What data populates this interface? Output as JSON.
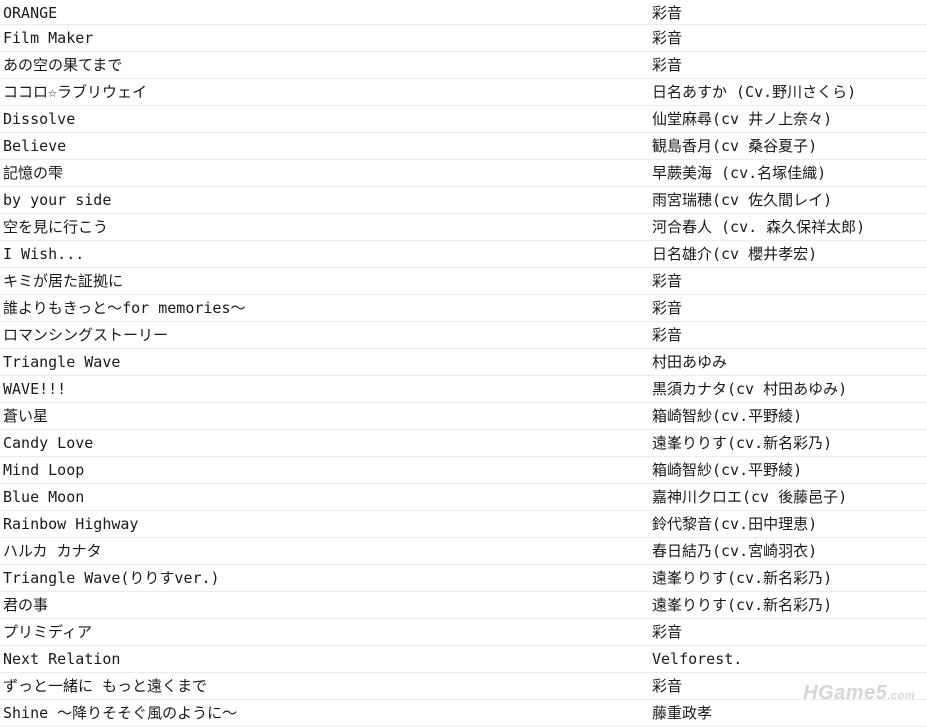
{
  "songs": [
    {
      "title": "ORANGE",
      "artist": "彩音"
    },
    {
      "title": "Film Maker",
      "artist": "彩音"
    },
    {
      "title": "あの空の果てまで",
      "artist": "彩音"
    },
    {
      "title": "ココロ☆ラブリウェイ",
      "artist": "日名あすか (Cv.野川さくら)"
    },
    {
      "title": "Dissolve",
      "artist": "仙堂麻尋(cv 井ノ上奈々)"
    },
    {
      "title": "Believe",
      "artist": "観島香月(cv 桑谷夏子)"
    },
    {
      "title": "記憶の雫",
      "artist": "早蕨美海 (cv.名塚佳織)"
    },
    {
      "title": "by your side",
      "artist": "雨宮瑞穂(cv 佐久間レイ)"
    },
    {
      "title": "空を見に行こう",
      "artist": "河合春人 (cv. 森久保祥太郎)"
    },
    {
      "title": "I Wish...",
      "artist": "日名雄介(cv 櫻井孝宏)"
    },
    {
      "title": "キミが居た証拠に",
      "artist": "彩音"
    },
    {
      "title": "誰よりもきっと～for memories～",
      "artist": "彩音"
    },
    {
      "title": "ロマンシングストーリー",
      "artist": "彩音"
    },
    {
      "title": "Triangle Wave",
      "artist": "村田あゆみ"
    },
    {
      "title": "WAVE!!!",
      "artist": "黒須カナタ(cv 村田あゆみ)"
    },
    {
      "title": "蒼い星",
      "artist": "箱崎智紗(cv.平野綾)"
    },
    {
      "title": "Candy Love",
      "artist": "遠峯りりす(cv.新名彩乃)"
    },
    {
      "title": "Mind Loop",
      "artist": "箱崎智紗(cv.平野綾)"
    },
    {
      "title": "Blue Moon",
      "artist": "嘉神川クロエ(cv 後藤邑子)"
    },
    {
      "title": "Rainbow Highway",
      "artist": "鈴代黎音(cv.田中理恵)"
    },
    {
      "title": "ハルカ カナタ",
      "artist": "春日結乃(cv.宮崎羽衣)"
    },
    {
      "title": "Triangle Wave(りりすver.)",
      "artist": "遠峯りりす(cv.新名彩乃)"
    },
    {
      "title": "君の事",
      "artist": "遠峯りりす(cv.新名彩乃)"
    },
    {
      "title": "プリミディア",
      "artist": "彩音"
    },
    {
      "title": "Next Relation",
      "artist": "Velforest."
    },
    {
      "title": "ずっと一緒に もっと遠くまで",
      "artist": "彩音"
    },
    {
      "title": "Shine ～降りそそぐ風のように～",
      "artist": "藤重政孝"
    }
  ],
  "watermark": {
    "main": "HGame5",
    "suffix": ".com"
  }
}
